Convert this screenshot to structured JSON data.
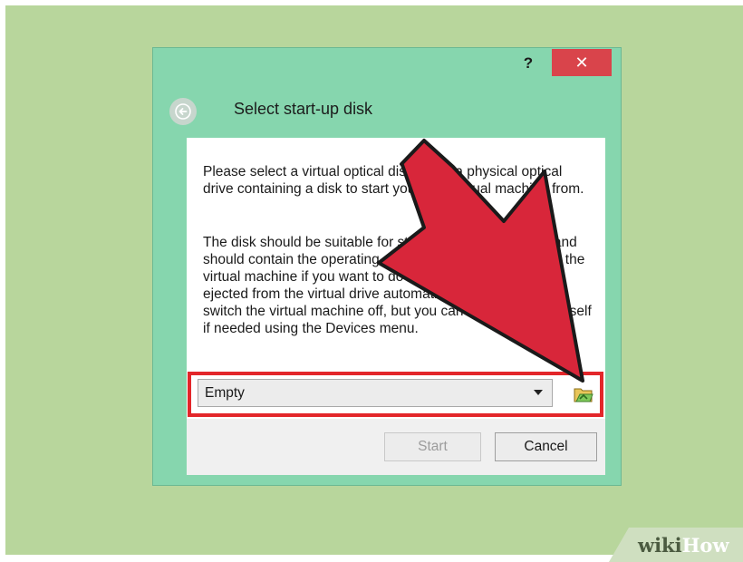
{
  "dialog": {
    "title": "Select start-up disk",
    "help_label": "?",
    "close_label": "✕"
  },
  "body": {
    "paragraph_1": "Please select a virtual optical disk file or a physical optical drive containing a disk to start your new virtual machine from.",
    "paragraph_2": "The disk should be suitable for starting a computer from and should contain the operating system you wish to install on the virtual machine if you want to do that now. The disk will be ejected from the virtual drive automatically next time you switch the virtual machine off, but you can also do this yourself if needed using the Devices menu."
  },
  "disk_select": {
    "value": "Empty"
  },
  "buttons": {
    "start_label": "Start",
    "cancel_label": "Cancel"
  },
  "watermark": {
    "part1": "wiki",
    "part2": "How"
  },
  "colors": {
    "dialog_bg": "#86d6ae",
    "close_red": "#d9444b",
    "highlight_red": "#e3262a",
    "arrow_red": "#d8263a",
    "page_bg": "#b8d69c"
  }
}
